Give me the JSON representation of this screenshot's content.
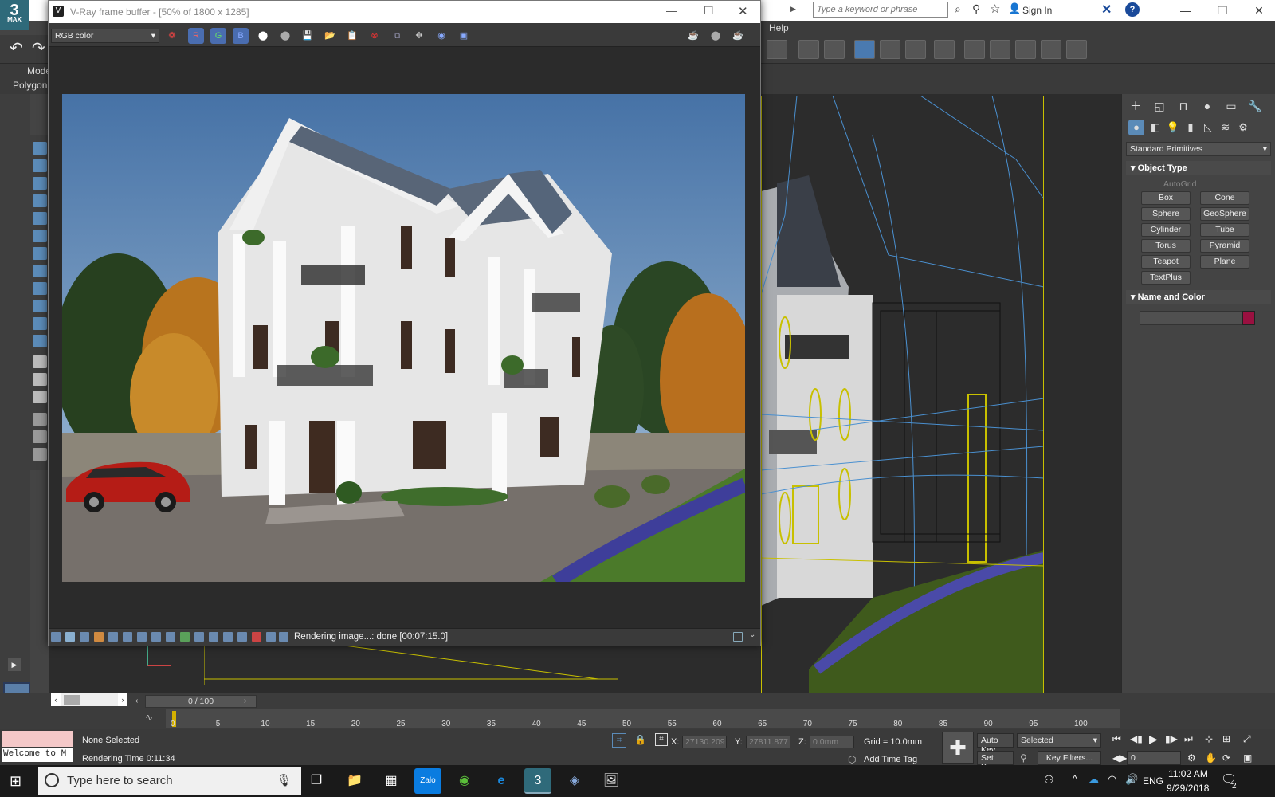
{
  "max": {
    "logo_text": "3",
    "logo_sub": "MAX",
    "search_placeholder": "Type a keyword or phrase",
    "sign_in": "Sign In",
    "menu_help": "Help",
    "left_labels": {
      "modeling": "Mode",
      "polygon": "Polygon"
    }
  },
  "vfb": {
    "title": "V-Ray frame buffer - [50% of 1800 x 1285]",
    "channel": "RGB color",
    "channel_buttons": [
      "R",
      "G",
      "B"
    ],
    "status": "Rendering image...: done [00:07:15.0]"
  },
  "command_panel": {
    "dropdown": "Standard Primitives",
    "object_type_title": "Object Type",
    "autogrid": "AutoGrid",
    "primitives": [
      "Box",
      "Cone",
      "Sphere",
      "GeoSphere",
      "Cylinder",
      "Tube",
      "Torus",
      "Pyramid",
      "Teapot",
      "Plane",
      "TextPlus"
    ],
    "name_color_title": "Name and Color",
    "swatch_color": "#9a1040"
  },
  "timeline": {
    "slider": "0 / 100",
    "ticks": [
      "0",
      "5",
      "10",
      "15",
      "20",
      "25",
      "30",
      "35",
      "40",
      "45",
      "50",
      "55",
      "60",
      "65",
      "70",
      "75",
      "80",
      "85",
      "90",
      "95",
      "100"
    ]
  },
  "status": {
    "selection": "None Selected",
    "render_time": "Rendering Time  0:11:34",
    "welcome": "Welcome to M",
    "x_label": "X:",
    "x_value": "27130.209",
    "y_label": "Y:",
    "y_value": "27811.877",
    "z_label": "Z:",
    "z_value": "0.0mm",
    "grid": "Grid = 10.0mm",
    "add_time_tag": "Add Time Tag",
    "auto_key": "Auto Key",
    "set_key": "Set Key",
    "selected": "Selected",
    "key_filters": "Key Filters...",
    "frame": "0"
  },
  "taskbar": {
    "search_placeholder": "Type here to search",
    "time": "11:02 AM",
    "date": "9/29/2018",
    "lang": "ENG",
    "notif_count": "2"
  }
}
